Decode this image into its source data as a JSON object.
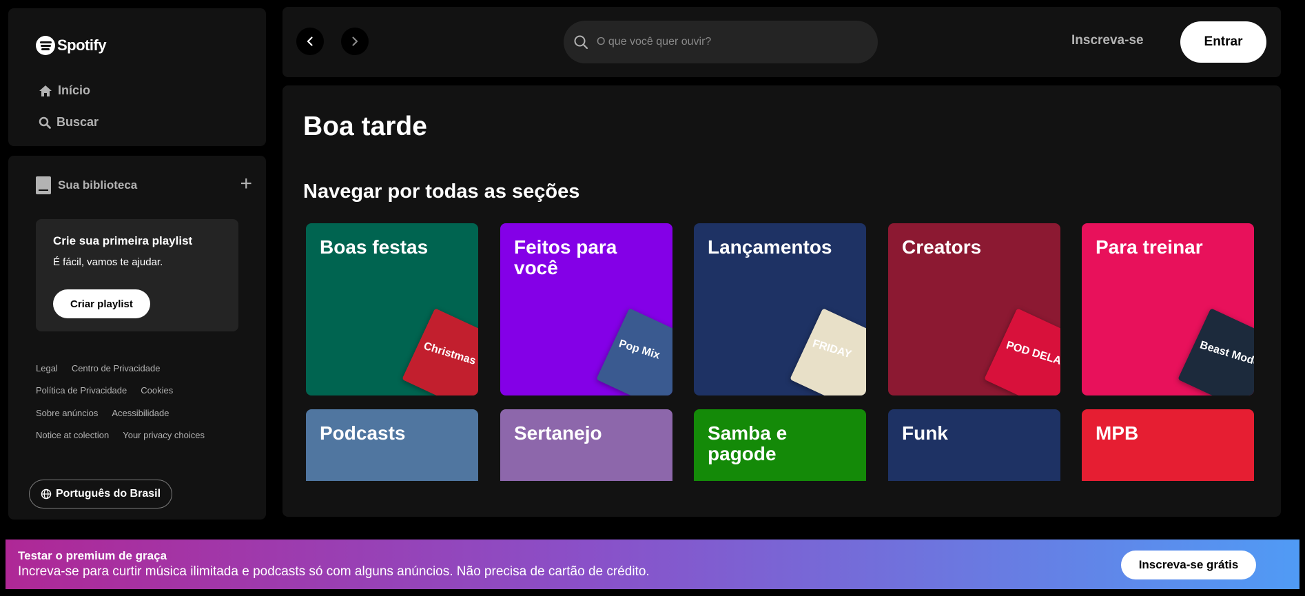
{
  "app": {
    "logo_text": "Spotify"
  },
  "sidebar": {
    "nav": [
      {
        "label": "Início",
        "icon": "home-icon"
      },
      {
        "label": "Buscar",
        "icon": "search-icon"
      }
    ],
    "library": {
      "title": "Sua biblioteca",
      "icon": "library-icon",
      "add_icon": "plus-icon",
      "card": {
        "title": "Crie sua primeira playlist",
        "subtitle": "É fácil, vamos te ajudar.",
        "button_label": "Criar playlist"
      },
      "links": [
        [
          "Legal",
          "Centro de Privacidade"
        ],
        [
          "Política de Privacidade",
          "Cookies"
        ],
        [
          "Sobre anúncios",
          "Acessibilidade"
        ],
        [
          "Notice at colection",
          "Your privacy choices"
        ]
      ],
      "language_label": "Português do Brasil",
      "language_icon": "globe-icon"
    }
  },
  "header": {
    "back_icon": "chevron-left-icon",
    "forward_icon": "chevron-right-icon",
    "search_placeholder": "O que você quer ouvir?",
    "signup_label": "Inscreva-se",
    "login_label": "Entrar"
  },
  "main": {
    "greeting": "Boa tarde",
    "section_title": "Navegar por todas as seções",
    "tiles": [
      {
        "label": "Boas festas",
        "color": "#006450",
        "cover_color": "#c21f2e",
        "cover_text": "Christmas Hits"
      },
      {
        "label": "Feitos para você",
        "color": "#8400e7",
        "cover_color": "#3a5a90",
        "cover_text": "Pop Mix"
      },
      {
        "label": "Lançamentos",
        "color": "#1e3264",
        "cover_color": "#e8e0c8",
        "cover_text": "FRIDAY"
      },
      {
        "label": "Creators",
        "color": "#8c1932",
        "cover_color": "#d8113b",
        "cover_text": "POD DELAS"
      },
      {
        "label": "Para treinar",
        "color": "#e8115b",
        "cover_color": "#1c2a3c",
        "cover_text": "Beast Mode"
      },
      {
        "label": "Podcasts",
        "color": "#5076a0",
        "cover_color": "#333333",
        "cover_text": ""
      },
      {
        "label": "Sertanejo",
        "color": "#8d67ab",
        "cover_color": "#333333",
        "cover_text": ""
      },
      {
        "label": "Samba e pagode",
        "color": "#148a08",
        "cover_color": "#333333",
        "cover_text": ""
      },
      {
        "label": "Funk",
        "color": "#1e3264",
        "cover_color": "#333333",
        "cover_text": ""
      },
      {
        "label": "MPB",
        "color": "#e61e32",
        "cover_color": "#333333",
        "cover_text": ""
      }
    ]
  },
  "banner": {
    "title": "Testar o premium de graça",
    "text": "Increva-se para curtir música ilimitada e podcasts só com alguns anúncios. Não precisa de cartão de crédito.",
    "button_label": "Inscreva-se grátis"
  }
}
